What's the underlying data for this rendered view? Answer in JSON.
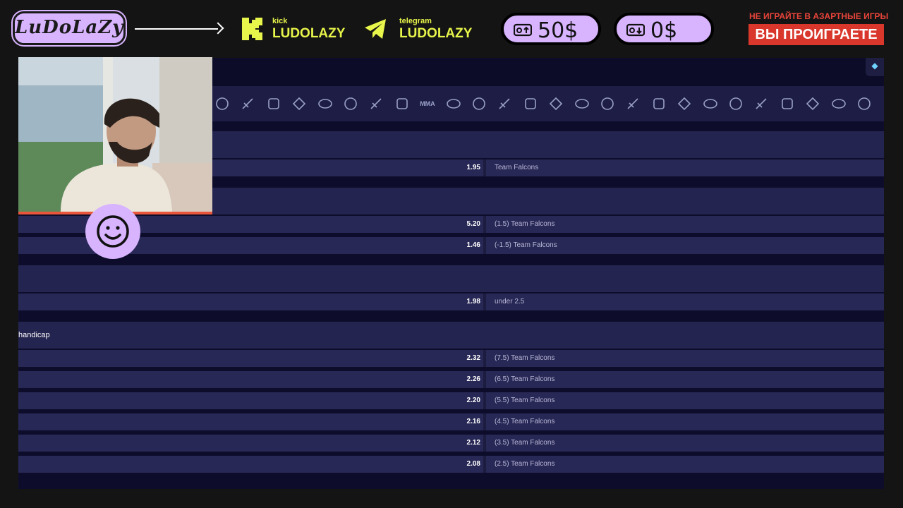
{
  "overlay": {
    "logo_text": "LuDoLaZy",
    "kick": {
      "label": "kick",
      "name": "LUDOLAZY"
    },
    "telegram": {
      "label": "telegram",
      "name": "LUDOLAZY"
    },
    "deposit": {
      "value": "50$"
    },
    "withdraw": {
      "value": "0$"
    },
    "warning_small": "НЕ ИГРАЙТЕ В АЗАРТНЫЕ ИГРЫ",
    "warning_big": "ВЫ ПРОИГРАЕТЕ",
    "colors": {
      "accent": "#d8b4fe",
      "yellow": "#e8f54a",
      "red": "#d9372b"
    }
  },
  "betting": {
    "sport_icons": [
      "sport-icon-1",
      "sport-icon-2",
      "sport-icon-3",
      "sport-icon-4",
      "sport-icon-5",
      "sport-icon-6",
      "sport-icon-7",
      "sport-icon-8",
      "sport-icon-mma",
      "sport-icon-10",
      "sport-icon-11",
      "sport-icon-12",
      "sport-icon-13",
      "sport-icon-14",
      "sport-icon-15",
      "sport-icon-16",
      "sport-icon-17",
      "sport-icon-18",
      "sport-icon-19",
      "sport-icon-20",
      "sport-icon-21",
      "sport-icon-22",
      "sport-icon-23",
      "sport-icon-24",
      "sport-icon-25",
      "sport-icon-26",
      "sport-icon-27"
    ],
    "mma_label": "MMA",
    "groups": [
      {
        "label": "",
        "rows": [
          {
            "odds": "1.95",
            "selection": "Team Falcons"
          }
        ]
      },
      {
        "label": "",
        "rows": [
          {
            "odds": "5.20",
            "selection": "(1.5) Team Falcons"
          },
          {
            "odds": "1.46",
            "selection": "(-1.5) Team Falcons"
          }
        ]
      },
      {
        "label": "",
        "rows": [
          {
            "odds": "1.98",
            "selection": "under 2.5"
          }
        ]
      },
      {
        "label": "handicap",
        "rows": [
          {
            "odds": "2.32",
            "selection": "(7.5) Team Falcons"
          },
          {
            "odds": "2.26",
            "selection": "(6.5) Team Falcons"
          },
          {
            "odds": "2.20",
            "selection": "(5.5) Team Falcons"
          },
          {
            "odds": "2.16",
            "selection": "(4.5) Team Falcons"
          },
          {
            "odds": "2.12",
            "selection": "(3.5) Team Falcons"
          },
          {
            "odds": "2.08",
            "selection": "(2.5) Team Falcons"
          }
        ]
      }
    ]
  }
}
